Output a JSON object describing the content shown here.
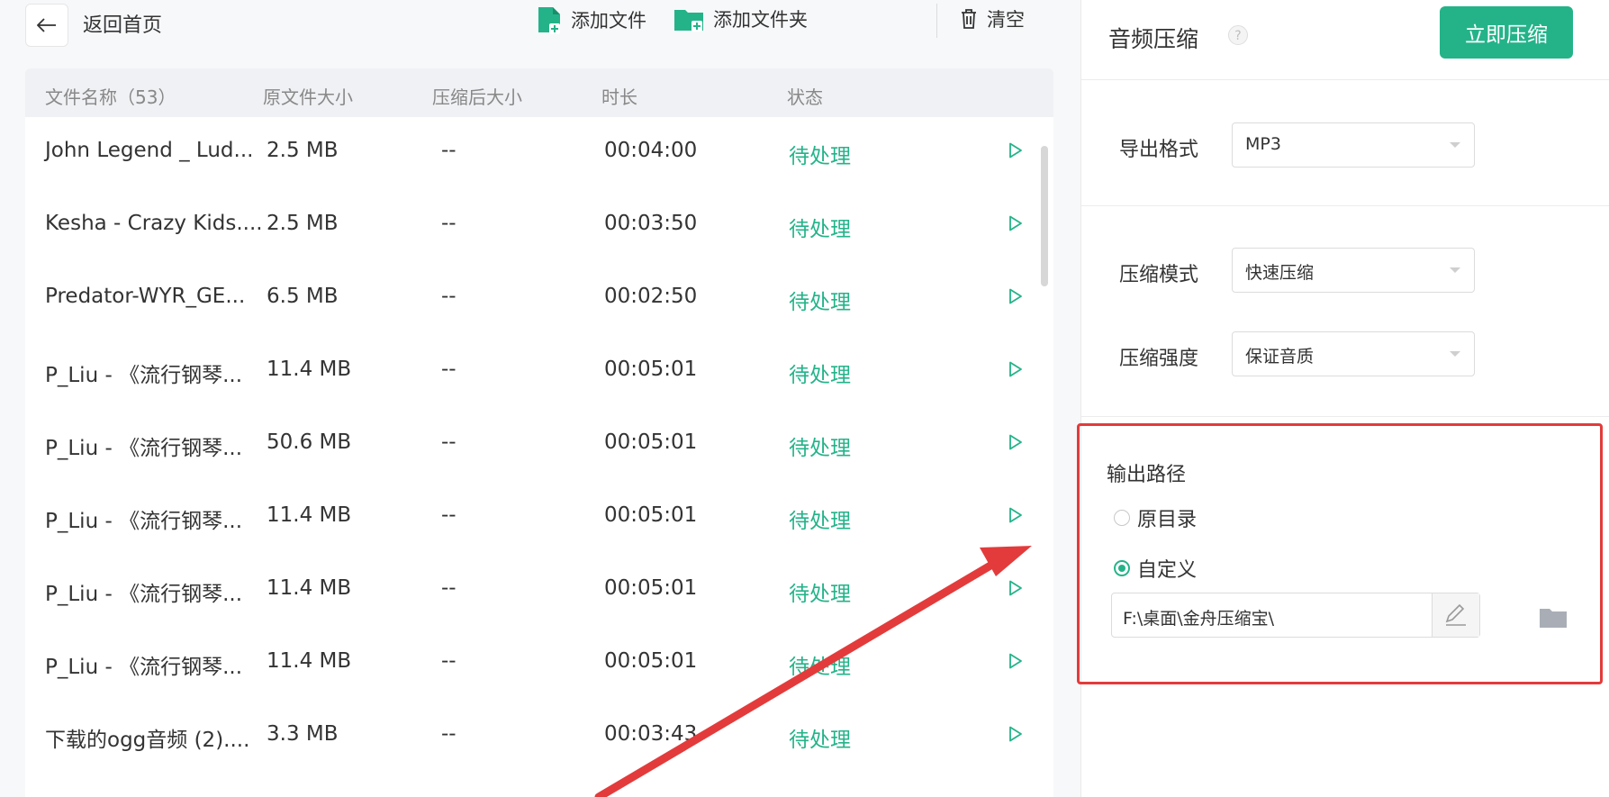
{
  "topbar": {
    "back_label": "返回首页",
    "add_file": "添加文件",
    "add_folder": "添加文件夹",
    "clear": "清空"
  },
  "table": {
    "headers": {
      "name": "文件名称（53）",
      "orig_size": "原文件大小",
      "compressed_size": "压缩后大小",
      "duration": "时长",
      "status": "状态"
    },
    "rows": [
      {
        "name": "John Legend _ Lud...",
        "size": "2.5 MB",
        "compressed": "--",
        "duration": "00:04:00",
        "status": "待处理"
      },
      {
        "name": "Kesha - Crazy Kids....",
        "size": "2.5 MB",
        "compressed": "--",
        "duration": "00:03:50",
        "status": "待处理"
      },
      {
        "name": "Predator-WYR_GE...",
        "size": "6.5 MB",
        "compressed": "--",
        "duration": "00:02:50",
        "status": "待处理"
      },
      {
        "name": "P_Liu - 《流行钢琴...",
        "size": "11.4 MB",
        "compressed": "--",
        "duration": "00:05:01",
        "status": "待处理"
      },
      {
        "name": "P_Liu - 《流行钢琴...",
        "size": "50.6 MB",
        "compressed": "--",
        "duration": "00:05:01",
        "status": "待处理"
      },
      {
        "name": "P_Liu - 《流行钢琴...",
        "size": "11.4 MB",
        "compressed": "--",
        "duration": "00:05:01",
        "status": "待处理"
      },
      {
        "name": "P_Liu - 《流行钢琴...",
        "size": "11.4 MB",
        "compressed": "--",
        "duration": "00:05:01",
        "status": "待处理"
      },
      {
        "name": "P_Liu - 《流行钢琴...",
        "size": "11.4 MB",
        "compressed": "--",
        "duration": "00:05:01",
        "status": "待处理"
      },
      {
        "name": "下载的ogg音频 (2)....",
        "size": "3.3 MB",
        "compressed": "--",
        "duration": "00:03:43",
        "status": "待处理"
      }
    ]
  },
  "sidebar": {
    "title": "音频压缩",
    "compress_button": "立即压缩",
    "export_format": {
      "label": "导出格式",
      "value": "MP3"
    },
    "compress_mode": {
      "label": "压缩模式",
      "value": "快速压缩"
    },
    "compress_strength": {
      "label": "压缩强度",
      "value": "保证音质"
    },
    "output": {
      "title": "输出路径",
      "option_original": "原目录",
      "option_custom": "自定义",
      "selected": "custom",
      "path": "F:\\桌面\\金舟压缩宝\\"
    }
  },
  "colors": {
    "accent": "#24b389",
    "highlight_border": "#e33b3b"
  }
}
